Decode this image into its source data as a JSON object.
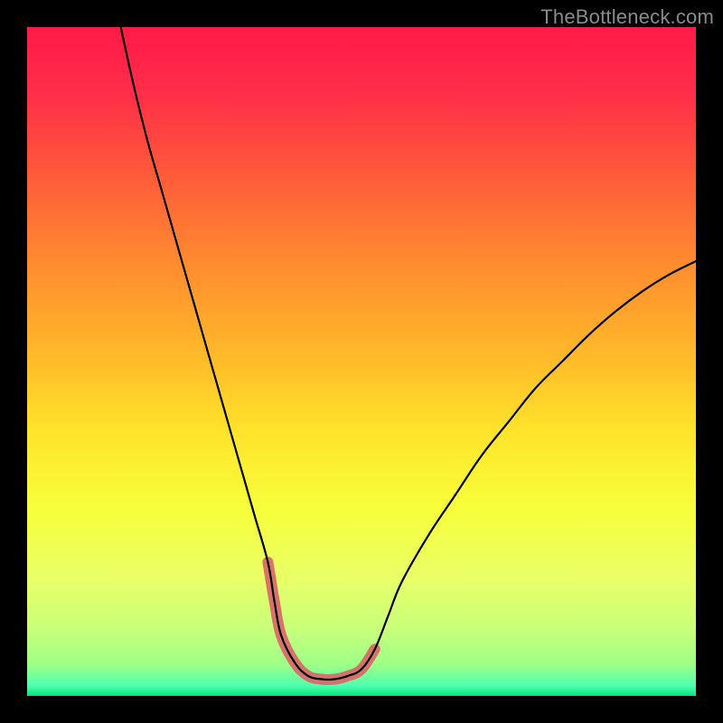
{
  "watermark": {
    "text": "TheBottleneck.com"
  },
  "gradient": {
    "stops": [
      {
        "offset": 0.0,
        "color": "#ff1a47"
      },
      {
        "offset": 0.1,
        "color": "#ff2e49"
      },
      {
        "offset": 0.22,
        "color": "#ff5a3a"
      },
      {
        "offset": 0.35,
        "color": "#ff8a2f"
      },
      {
        "offset": 0.48,
        "color": "#ffb52a"
      },
      {
        "offset": 0.6,
        "color": "#ffe22a"
      },
      {
        "offset": 0.72,
        "color": "#f7ff3a"
      },
      {
        "offset": 0.82,
        "color": "#eaff66"
      },
      {
        "offset": 0.9,
        "color": "#c8ff7a"
      },
      {
        "offset": 0.955,
        "color": "#9cff88"
      },
      {
        "offset": 0.985,
        "color": "#4dffb0"
      },
      {
        "offset": 1.0,
        "color": "#00e676"
      }
    ]
  },
  "chart_data": {
    "type": "line",
    "title": "",
    "xlabel": "",
    "ylabel": "",
    "xlim": [
      0,
      100
    ],
    "ylim": [
      0,
      100
    ],
    "series": [
      {
        "name": "bottleneck-curve",
        "color": "#000000",
        "width": 2.2,
        "x": [
          14,
          16,
          18,
          20,
          22,
          24,
          26,
          28,
          30,
          32,
          34,
          36,
          37,
          38,
          40,
          42,
          44,
          46,
          48,
          50,
          52,
          54,
          56,
          60,
          64,
          68,
          72,
          76,
          80,
          84,
          88,
          92,
          96,
          100
        ],
        "y": [
          100,
          91,
          83,
          76,
          69,
          62,
          55,
          48,
          41,
          34,
          27,
          20,
          14,
          9,
          5,
          3,
          2.5,
          2.5,
          3,
          4,
          7,
          12,
          17,
          24,
          30,
          36,
          41,
          46,
          50,
          54,
          57.5,
          60.5,
          63,
          65
        ]
      },
      {
        "name": "optimal-zone-highlight",
        "color": "#d96a6a",
        "width": 12,
        "linecap": "round",
        "x": [
          36,
          37,
          38,
          40,
          42,
          44,
          46,
          48,
          50,
          52
        ],
        "y": [
          20,
          14,
          9,
          5,
          3,
          2.5,
          2.5,
          3,
          4,
          7
        ]
      }
    ]
  }
}
